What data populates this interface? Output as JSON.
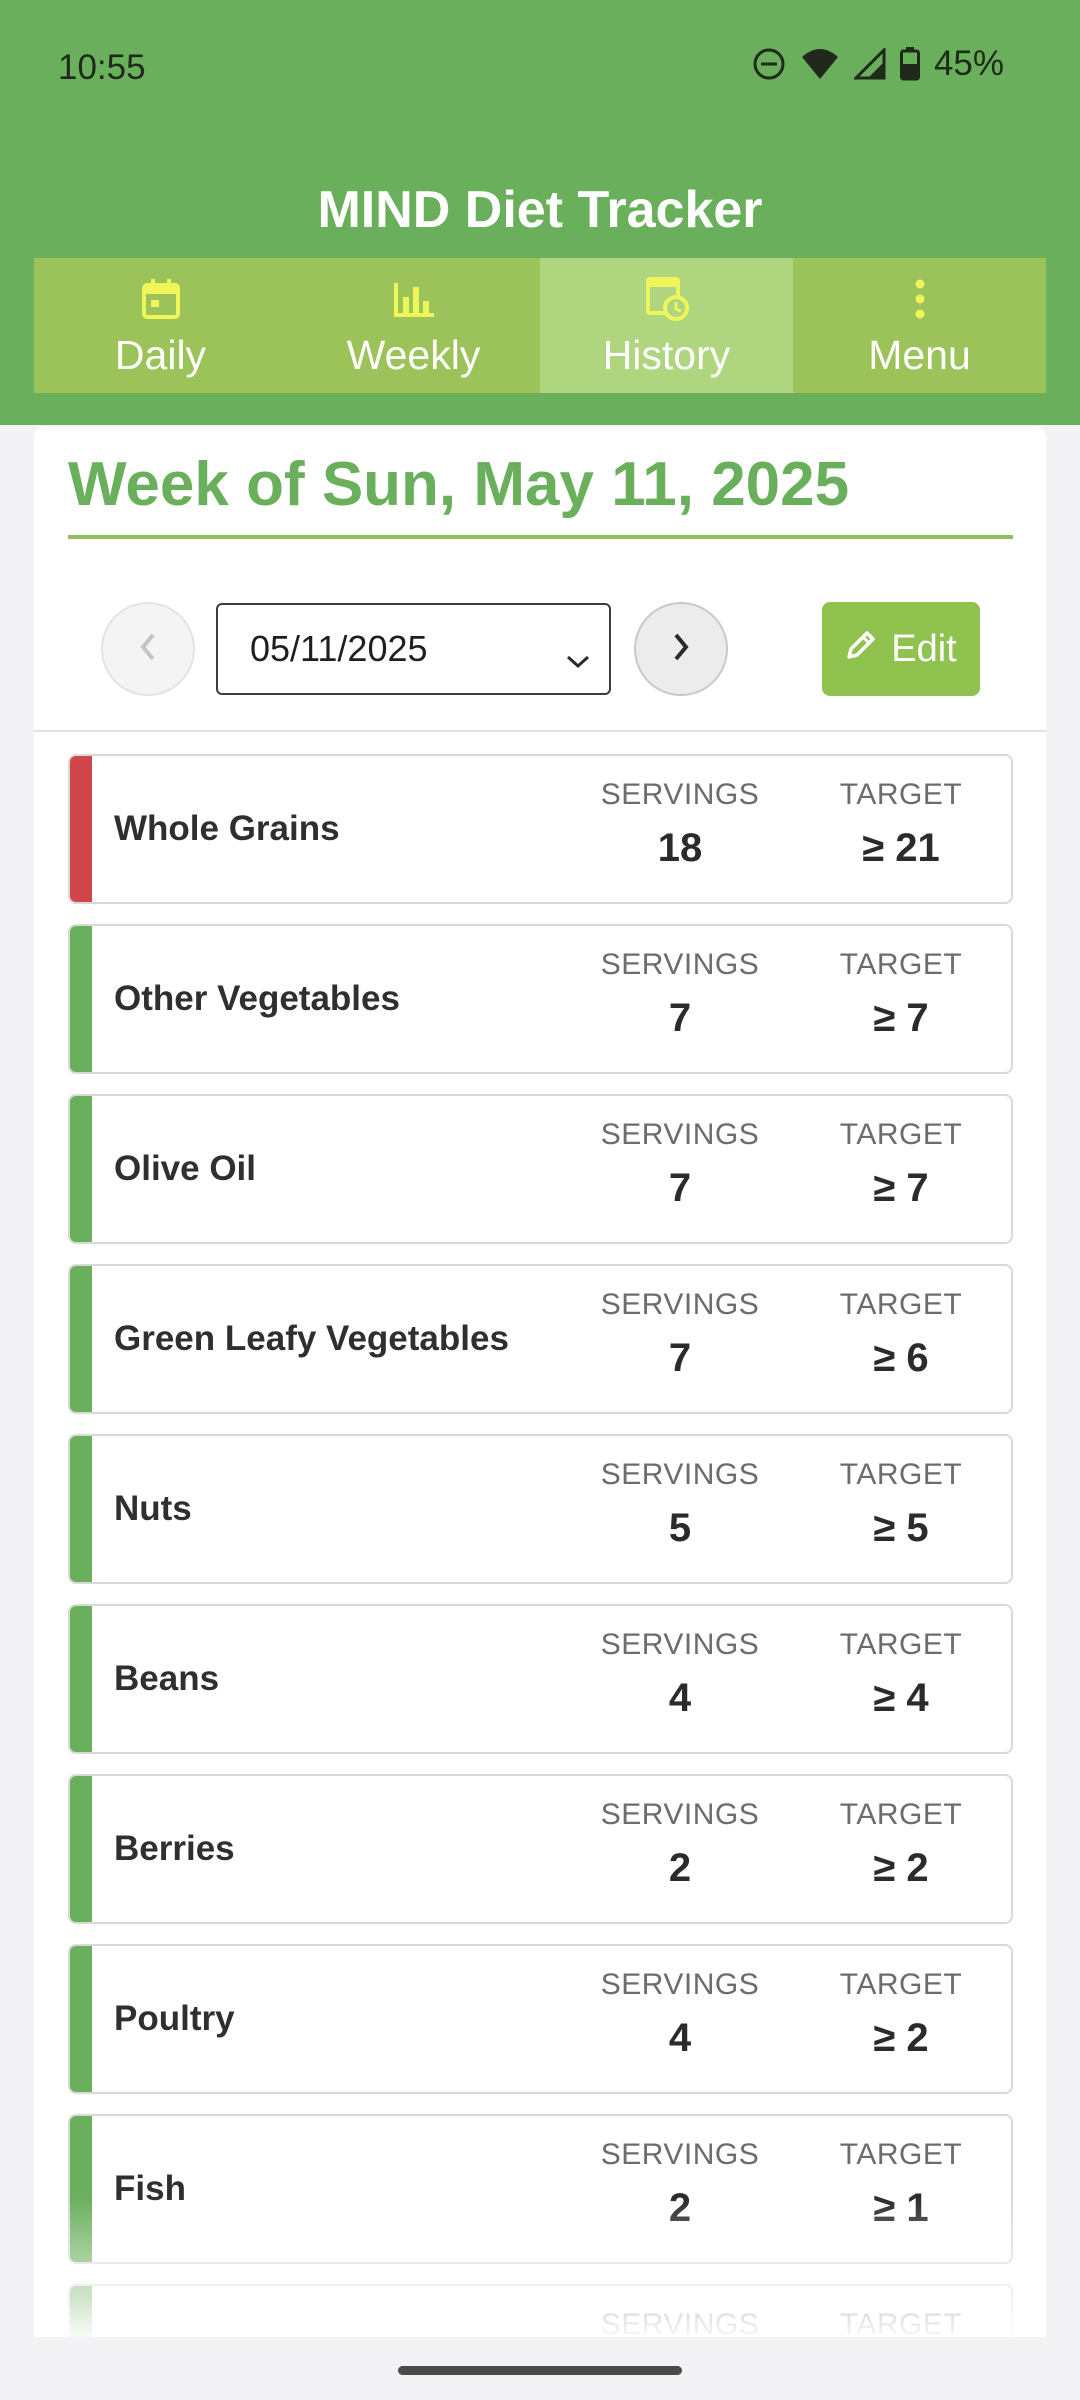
{
  "status_bar": {
    "time": "10:55",
    "battery": "45%"
  },
  "header": {
    "title": "MIND Diet Tracker"
  },
  "tabs": [
    {
      "label": "Daily",
      "icon": "calendar-icon"
    },
    {
      "label": "Weekly",
      "icon": "bar-chart-icon"
    },
    {
      "label": "History",
      "icon": "history-icon",
      "active": true
    },
    {
      "label": "Menu",
      "icon": "more-vertical-icon"
    }
  ],
  "week": {
    "title": "Week of Sun, May 11, 2025",
    "selected_date": "05/11/2025",
    "edit_label": "Edit"
  },
  "labels": {
    "servings": "SERVINGS",
    "target": "TARGET"
  },
  "colors": {
    "header_green": "#6aaf5b",
    "tab_bar": "#9bc35a",
    "met": "#6aaf5b",
    "unmet": "#d0464b",
    "edit_button": "#8fc24f"
  },
  "food_groups": [
    {
      "name": "Whole Grains",
      "servings": "18",
      "target": "≥ 21",
      "status": "unmet"
    },
    {
      "name": "Other Vegetables",
      "servings": "7",
      "target": "≥ 7",
      "status": "met"
    },
    {
      "name": "Olive Oil",
      "servings": "7",
      "target": "≥ 7",
      "status": "met"
    },
    {
      "name": "Green Leafy Vegetables",
      "servings": "7",
      "target": "≥ 6",
      "status": "met"
    },
    {
      "name": "Nuts",
      "servings": "5",
      "target": "≥ 5",
      "status": "met"
    },
    {
      "name": "Beans",
      "servings": "4",
      "target": "≥ 4",
      "status": "met"
    },
    {
      "name": "Berries",
      "servings": "2",
      "target": "≥ 2",
      "status": "met"
    },
    {
      "name": "Poultry",
      "servings": "4",
      "target": "≥ 2",
      "status": "met"
    },
    {
      "name": "Fish",
      "servings": "2",
      "target": "≥ 1",
      "status": "met"
    },
    {
      "name": "",
      "servings": "",
      "target": "",
      "status": "met"
    }
  ]
}
